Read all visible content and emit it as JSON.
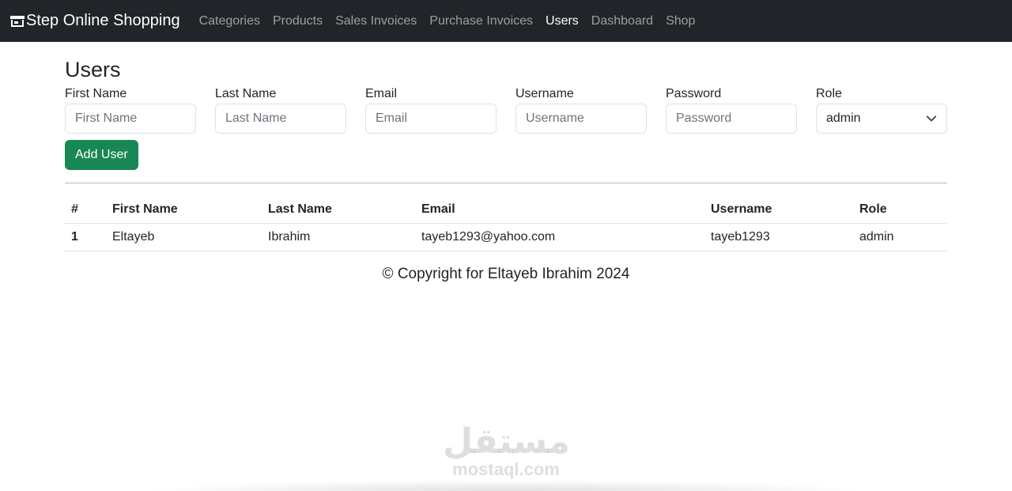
{
  "navbar": {
    "brand": "Step Online Shopping",
    "brand_icon": "shop-icon",
    "links": [
      {
        "label": "Categories",
        "active": false
      },
      {
        "label": "Products",
        "active": false
      },
      {
        "label": "Sales Invoices",
        "active": false
      },
      {
        "label": "Purchase Invoices",
        "active": false
      },
      {
        "label": "Users",
        "active": true
      },
      {
        "label": "Dashboard",
        "active": false
      },
      {
        "label": "Shop",
        "active": false
      }
    ]
  },
  "page": {
    "title": "Users"
  },
  "form": {
    "first_name": {
      "label": "First Name",
      "placeholder": "First Name",
      "value": ""
    },
    "last_name": {
      "label": "Last Name",
      "placeholder": "Last Name",
      "value": ""
    },
    "email": {
      "label": "Email",
      "placeholder": "Email",
      "value": ""
    },
    "username": {
      "label": "Username",
      "placeholder": "Username",
      "value": ""
    },
    "password": {
      "label": "Password",
      "placeholder": "Password",
      "value": ""
    },
    "role": {
      "label": "Role",
      "selected": "admin"
    },
    "submit_label": "Add User"
  },
  "table": {
    "headers": [
      "#",
      "First Name",
      "Last Name",
      "Email",
      "Username",
      "Role"
    ],
    "rows": [
      [
        "1",
        "Eltayeb",
        "Ibrahim",
        "tayeb1293@yahoo.com",
        "tayeb1293",
        "admin"
      ]
    ]
  },
  "footer": {
    "text": "© Copyright for Eltayeb Ibrahim 2024"
  },
  "watermark": {
    "arabic": "مستقل",
    "latin": "mostaql.com"
  },
  "colors": {
    "navbar_bg": "#212529",
    "success": "#198754",
    "nav_muted": "rgba(255,255,255,0.55)"
  }
}
